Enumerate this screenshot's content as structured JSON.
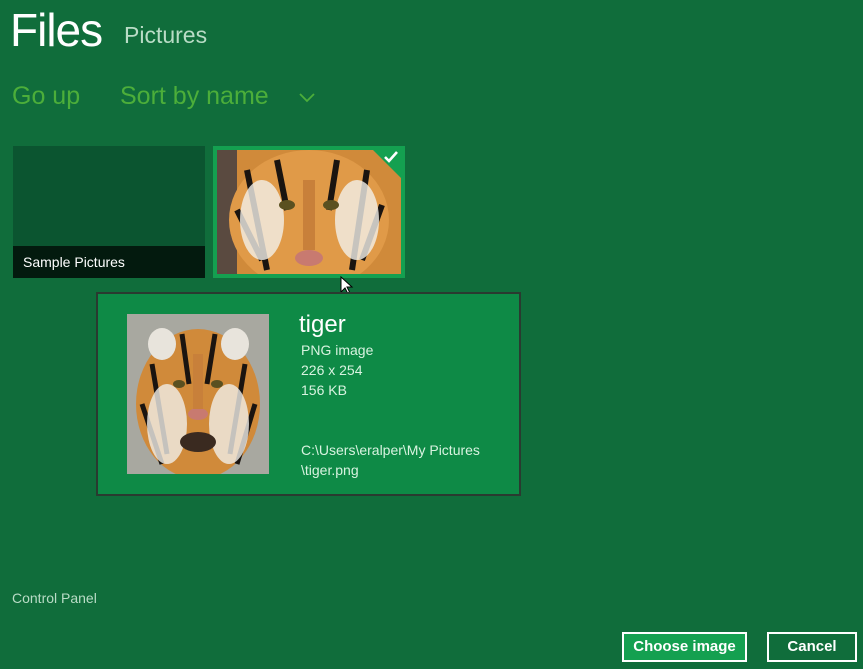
{
  "header": {
    "title": "Files",
    "location": "Pictures"
  },
  "commands": {
    "go_up": "Go up",
    "sort": "Sort by name"
  },
  "items": [
    {
      "label": "Sample Pictures",
      "type": "folder",
      "selected": false
    },
    {
      "label": "tiger",
      "type": "image",
      "selected": true
    }
  ],
  "tooltip": {
    "name": "tiger",
    "type": "PNG image",
    "dimensions": "226 x 254",
    "size": "156 KB",
    "path_line1": "C:\\Users\\eralper\\My Pictures",
    "path_line2": "\\tiger.png"
  },
  "sidebar": {
    "location_link": "Control Panel"
  },
  "footer": {
    "choose_label": "Choose image",
    "cancel_label": "Cancel"
  },
  "colors": {
    "background": "#106d3b",
    "accent": "#14a050",
    "command": "#4cae3a"
  }
}
